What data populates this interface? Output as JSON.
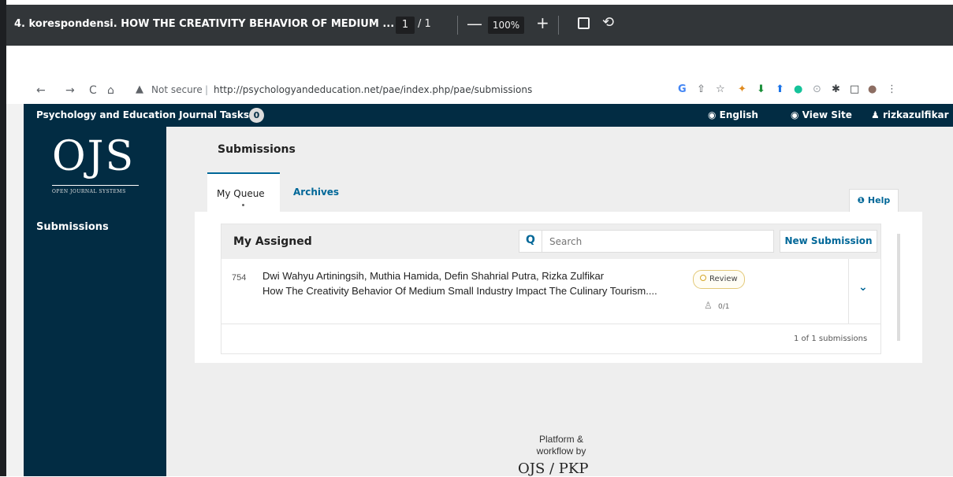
{
  "pdf_toolbar": {
    "title": "4. korespondensi. HOW THE CREATIVITY BEHAVIOR OF MEDIUM ...",
    "page_current": "1",
    "page_total": "/ 1",
    "zoom": "100%",
    "minus": "—",
    "plus": "+",
    "rotate_glyph": "⟲",
    "more_glyph": "⋮"
  },
  "browser": {
    "back": "←",
    "forward": "→",
    "reload": "C",
    "home": "⌂",
    "warning_glyph": "▲",
    "security_text": "Not secure",
    "divider": "|",
    "url": "http://psychologyandeducation.net/pae/index.php/pae/submissions",
    "more_glyph": "⋮"
  },
  "header": {
    "journal_title": "Psychology and Education Journal",
    "tasks_label": "Tasks",
    "tasks_count": "0",
    "language": "English",
    "view_site": "View Site",
    "username": "rizkazulfikar"
  },
  "sidebar": {
    "logo_text": "OJS",
    "logo_subtitle": "OPEN JOURNAL SYSTEMS",
    "nav_item": "Submissions"
  },
  "main": {
    "page_title": "Submissions",
    "tabs": [
      {
        "label": "My Queue"
      },
      {
        "label": "Archives"
      }
    ],
    "help_label": "Help",
    "list": {
      "title": "My Assigned",
      "search_placeholder": "Search",
      "new_submission": "New Submission",
      "submissions": [
        {
          "id": "754",
          "authors": "Dwi Wahyu Artiningsih, Muthia Hamida, Defin Shahrial Putra, Rizka Zulfikar",
          "title": "How The Creativity Behavior Of Medium Small Industry Impact The Culinary Tourism....",
          "stage": "Review",
          "reviews": "0/1"
        }
      ],
      "count_text": "1 of 1 submissions"
    }
  },
  "footer": {
    "line1": "Platform &",
    "line2": "workflow by",
    "brand": "OJS / PKP"
  },
  "colors": {
    "header_bg": "#022c43",
    "accent": "#006798",
    "stage_review": "#d4a628"
  }
}
